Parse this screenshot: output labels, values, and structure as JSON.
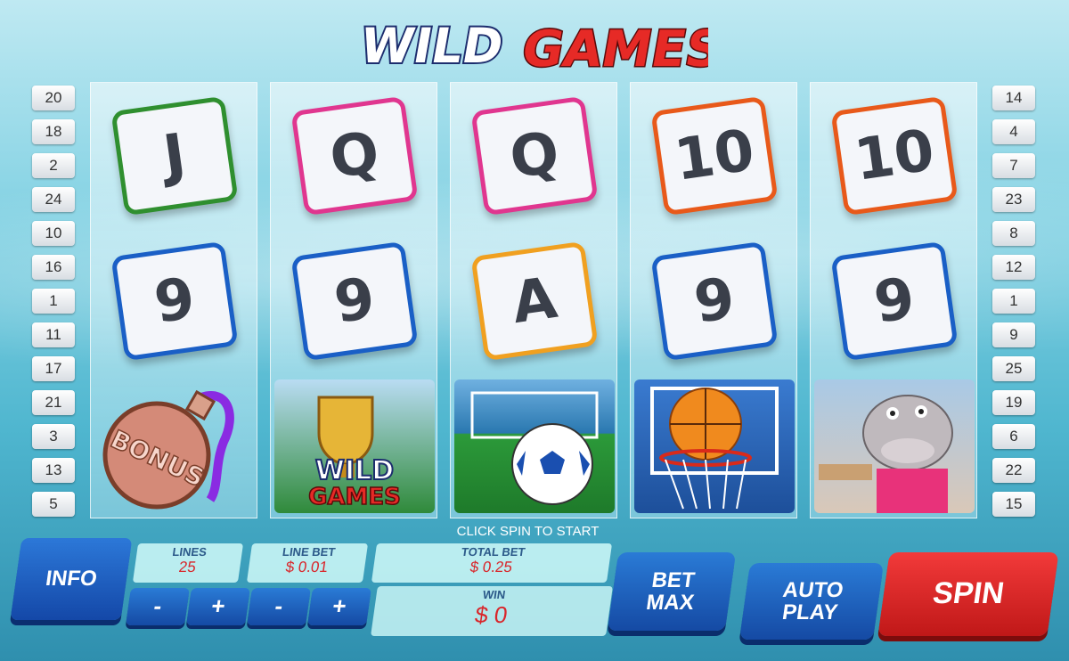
{
  "logo": {
    "word1": "WILD",
    "word2": "GAMES"
  },
  "reels": [
    {
      "symbols": [
        "J",
        "9",
        "BONUS"
      ]
    },
    {
      "symbols": [
        "Q",
        "9",
        "WILD GAMES"
      ]
    },
    {
      "symbols": [
        "Q",
        "A",
        "soccer-ball"
      ]
    },
    {
      "symbols": [
        "10",
        "9",
        "basketball"
      ]
    },
    {
      "symbols": [
        "10",
        "9",
        "hippo"
      ]
    }
  ],
  "left_lines": [
    "20",
    "18",
    "2",
    "24",
    "10",
    "16",
    "1",
    "11",
    "17",
    "21",
    "3",
    "13",
    "5"
  ],
  "right_lines": [
    "14",
    "4",
    "7",
    "23",
    "8",
    "12",
    "1",
    "9",
    "25",
    "19",
    "6",
    "22",
    "15"
  ],
  "status_text": "CLICK SPIN TO START",
  "controls": {
    "info_label": "INFO",
    "lines_label": "LINES",
    "lines_value": "25",
    "line_bet_label": "LINE BET",
    "line_bet_value": "$ 0.01",
    "total_bet_label": "TOTAL BET",
    "total_bet_value": "$ 0.25",
    "win_label": "WIN",
    "win_value": "$ 0",
    "minus": "-",
    "plus": "+",
    "bet_max_label_1": "BET",
    "bet_max_label_2": "MAX",
    "auto_play_label_1": "AUTO",
    "auto_play_label_2": "PLAY",
    "spin_label": "SPIN"
  },
  "colors": {
    "red": "#e8262b",
    "blue": "#1a5fc6",
    "cyan_panel": "#c8f5f5"
  }
}
